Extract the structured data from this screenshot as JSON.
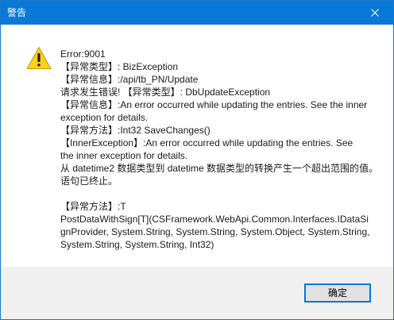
{
  "window": {
    "title": "警告",
    "title_bar_color": "#0a78d7",
    "close_icon": "close-icon"
  },
  "dialog": {
    "icon": "warning-icon",
    "message_lines": [
      "Error:9001",
      "【异常类型】: BizException",
      "【异常信息】:/api/tb_PN/Update",
      "请求发生错误! 【异常类型】: DbUpdateException",
      "【异常信息】:An error occurred while updating the entries. See the inner",
      "exception for details.",
      "【异常方法】:Int32 SaveChanges()",
      "【InnerException】:An error occurred while updating the entries. See",
      "the inner exception for details.",
      "从 datetime2 数据类型到 datetime 数据类型的转换产生一个超出范围的值。",
      "语句已终止。",
      "",
      "【异常方法】:T",
      "PostDataWithSign[T](CSFramework.WebApi.Common.Interfaces.IDataSi",
      "gnProvider, System.String, System.String, System.Object, System.String,",
      "System.String, System.String, Int32)"
    ],
    "ok_label": "确定"
  }
}
